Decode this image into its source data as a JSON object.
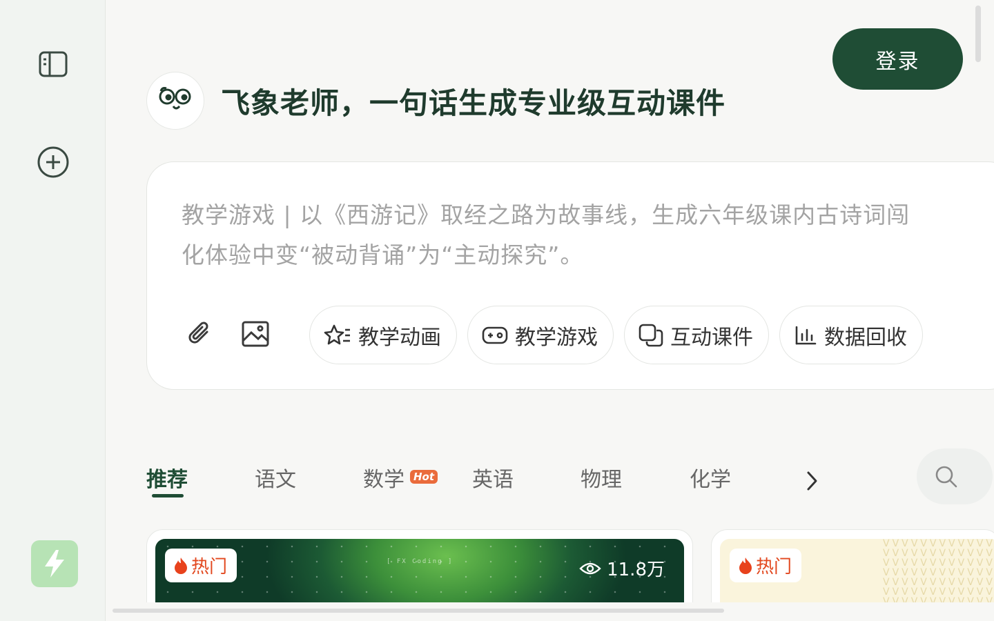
{
  "header": {
    "login_label": "登录"
  },
  "hero": {
    "title": "飞象老师，一句话生成专业级互动课件"
  },
  "prompt": {
    "placeholder_line1": "教学游戏 | 以《西游记》取经之路为故事线，生成六年级课内古诗词闯",
    "placeholder_line2": "化体验中变“被动背诵”为“主动探究”。",
    "chips": [
      {
        "label": "教学动画",
        "icon": "sparkle-star-icon"
      },
      {
        "label": "教学游戏",
        "icon": "gamepad-icon"
      },
      {
        "label": "互动课件",
        "icon": "copy-pages-icon"
      },
      {
        "label": "数据回收",
        "icon": "bar-chart-icon"
      }
    ],
    "tools": [
      "paperclip-icon",
      "image-icon"
    ]
  },
  "tabs": {
    "items": [
      "推荐",
      "语文",
      "数学",
      "英语",
      "物理",
      "化学"
    ],
    "active": "推荐",
    "hot_badge": "Hot"
  },
  "cards": [
    {
      "tag": "热门",
      "views": "11.8万",
      "caption": "[ FX Coding ]"
    },
    {
      "tag": "热门"
    }
  ],
  "colors": {
    "brand": "#1f4d35",
    "hot": "#e2471e",
    "badge": "#ea6b3b",
    "logo_bg": "#b7e3b5"
  }
}
